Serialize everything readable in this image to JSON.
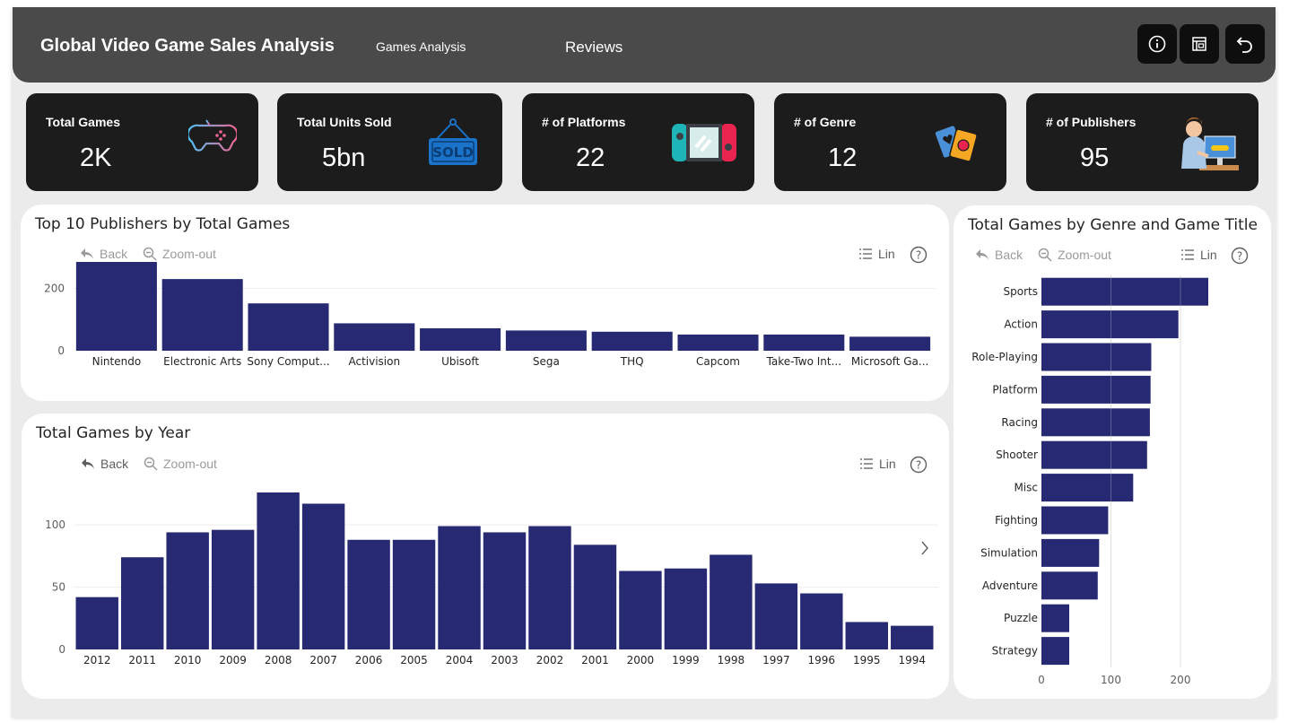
{
  "header": {
    "title": "Global Video Game Sales Analysis",
    "tabs": [
      {
        "label": "Games Analysis"
      },
      {
        "label": "Reviews"
      }
    ],
    "buttons": [
      "info-icon",
      "report-icon",
      "undo-icon"
    ]
  },
  "kpis": [
    {
      "label": "Total Games",
      "value": "2K",
      "icon": "gamepad-icon"
    },
    {
      "label": "Total Units Sold",
      "value": "5bn",
      "icon": "sold-sign-icon"
    },
    {
      "label": "# of Platforms",
      "value": "22",
      "icon": "handheld-console-icon"
    },
    {
      "label": "# of Genre",
      "value": "12",
      "icon": "playing-cards-icon"
    },
    {
      "label": "# of Publishers",
      "value": "95",
      "icon": "gamer-person-icon"
    }
  ],
  "toolbar": {
    "back": "Back",
    "zoom_out": "Zoom-out",
    "lin": "Lin",
    "help": "?"
  },
  "charts": {
    "publishers": {
      "title": "Top 10 Publishers by Total Games"
    },
    "genre": {
      "title": "Total Games by Genre and Game Title"
    },
    "year": {
      "title": "Total Games by Year"
    }
  },
  "colors": {
    "bar": "#272a72",
    "header": "#4a4a4a",
    "kpi_bg": "#1c1c1c",
    "page_bg": "#ebebeb"
  },
  "chart_data": [
    {
      "type": "bar",
      "title": "Top 10 Publishers by Total Games",
      "categories": [
        "Nintendo",
        "Electronic Arts",
        "Sony Comput...",
        "Activision",
        "Ubisoft",
        "Sega",
        "THQ",
        "Capcom",
        "Take-Two Int...",
        "Microsoft Ga..."
      ],
      "values": [
        285,
        230,
        152,
        88,
        72,
        65,
        61,
        52,
        52,
        45
      ],
      "ylim": [
        0,
        285
      ],
      "yticks": [
        0,
        200
      ],
      "grid": true
    },
    {
      "type": "bar",
      "orientation": "horizontal",
      "title": "Total Games by Genre and Game Title",
      "categories": [
        "Sports",
        "Action",
        "Role-Playing",
        "Platform",
        "Racing",
        "Shooter",
        "Misc",
        "Fighting",
        "Simulation",
        "Adventure",
        "Puzzle",
        "Strategy"
      ],
      "values": [
        240,
        197,
        158,
        157,
        156,
        152,
        132,
        96,
        83,
        81,
        40,
        40
      ],
      "xlim": [
        0,
        240
      ],
      "xticks": [
        0,
        100,
        200
      ],
      "grid": true
    },
    {
      "type": "bar",
      "title": "Total Games by Year",
      "categories": [
        "2012",
        "2011",
        "2010",
        "2009",
        "2008",
        "2007",
        "2006",
        "2005",
        "2004",
        "2003",
        "2002",
        "2001",
        "2000",
        "1999",
        "1998",
        "1997",
        "1996",
        "1995",
        "1994"
      ],
      "values": [
        42,
        74,
        94,
        96,
        126,
        117,
        88,
        88,
        99,
        94,
        99,
        84,
        63,
        65,
        76,
        53,
        45,
        22,
        19
      ],
      "ylim": [
        0,
        126
      ],
      "yticks": [
        0,
        50,
        100
      ],
      "grid": true
    }
  ]
}
